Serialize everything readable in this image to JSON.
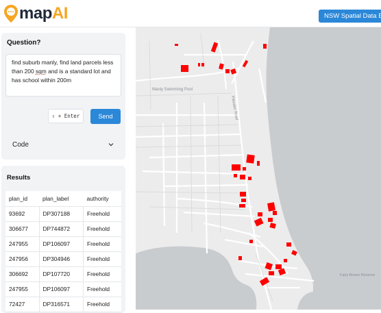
{
  "app": {
    "logo_text": "map",
    "logo_accent": "AI",
    "nsw_button": "NSW Spatial Data Exp"
  },
  "question": {
    "title": "Question?",
    "text_before": "find suburb manly, find land parcels less than 200 ",
    "text_underlined": "sqm",
    "text_after": " and is a standard lot and has school within 200m",
    "shortcut": "⇧ + Enter",
    "send_label": "Send"
  },
  "code": {
    "label": "Code"
  },
  "results": {
    "title": "Results",
    "columns": [
      "plan_id",
      "plan_label",
      "authority"
    ],
    "rows": [
      [
        "93692",
        "DP307188",
        "Freehold"
      ],
      [
        "306677",
        "DP744872",
        "Freehold"
      ],
      [
        "247955",
        "DP106097",
        "Freehold"
      ],
      [
        "247956",
        "DP304946",
        "Freehold"
      ],
      [
        "306692",
        "DP107720",
        "Freehold"
      ],
      [
        "247955",
        "DP106097",
        "Freehold"
      ],
      [
        "72427",
        "DP316571",
        "Freehold"
      ]
    ]
  },
  "map": {
    "labels": {
      "pool": "Manly Swimming Pool",
      "street": "Pittwater Road",
      "reserve": "Fairy Bower Reserve"
    },
    "parcel_color": "#ff0000",
    "water_color": "#c9cccf",
    "land_color": "#ececec"
  }
}
